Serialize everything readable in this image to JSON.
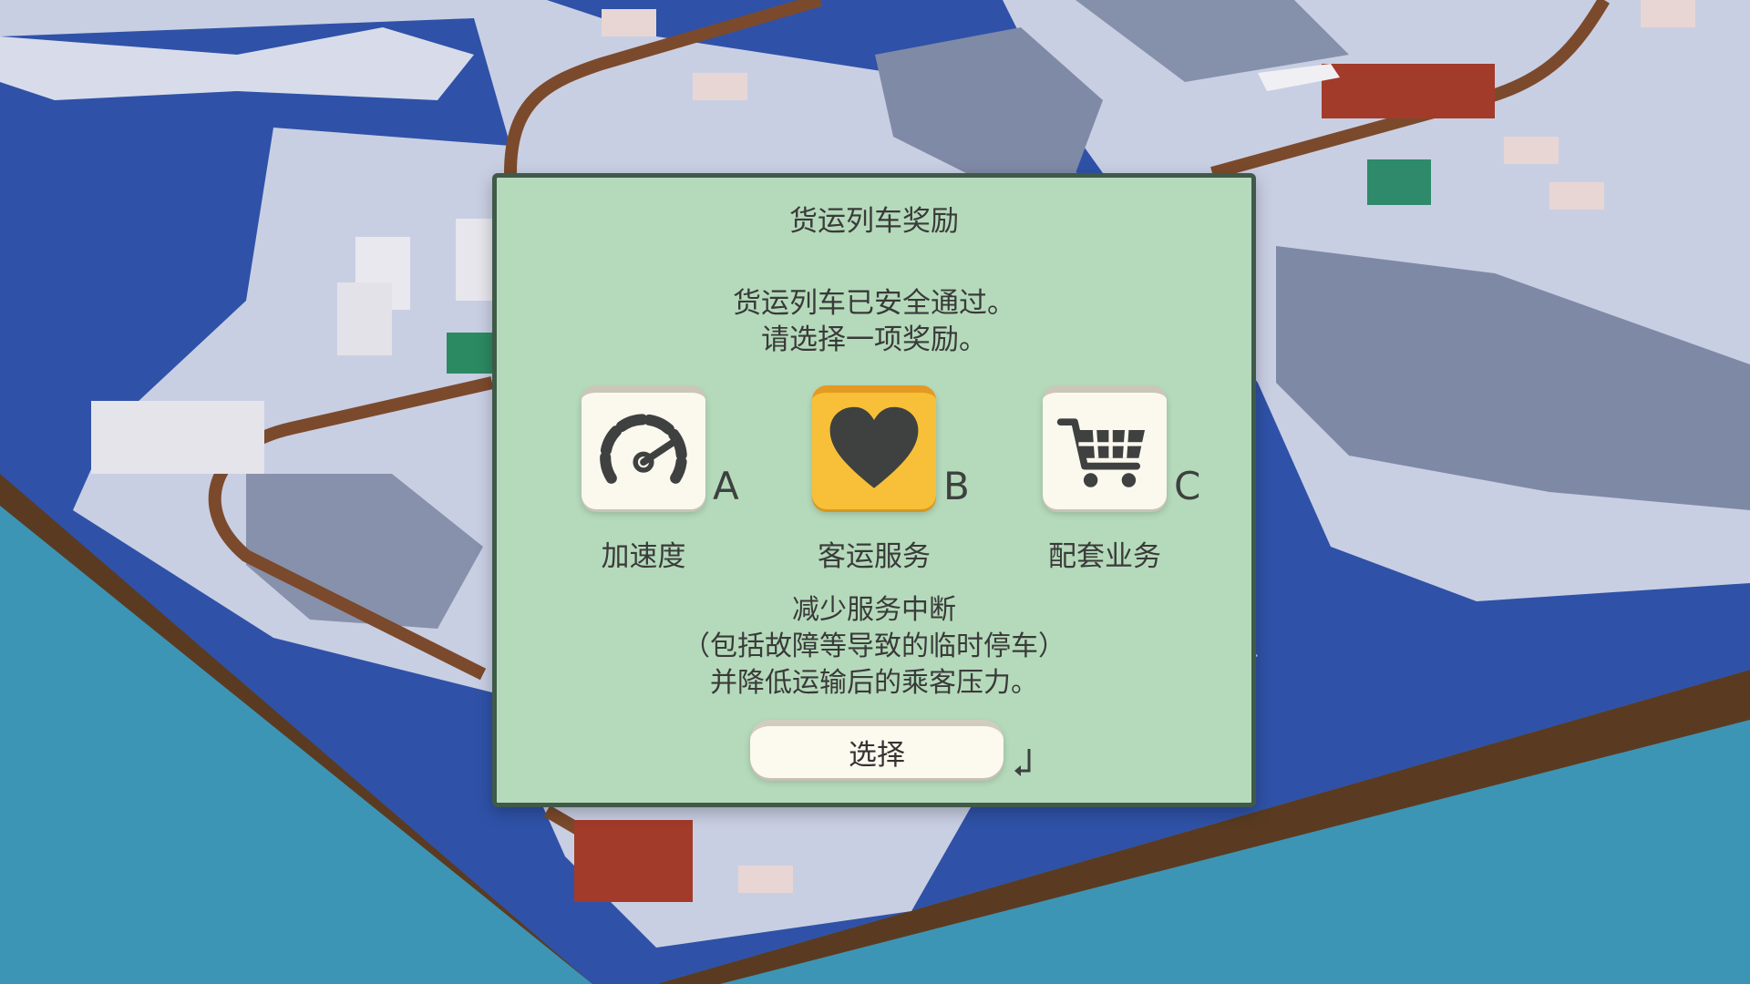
{
  "dialog": {
    "title": "货运列车奖励",
    "message_lines": [
      "货运列车已安全通过。",
      "请选择一项奖励。"
    ],
    "options": [
      {
        "key": "A",
        "label": "加速度",
        "icon": "speedometer-icon",
        "selected": false
      },
      {
        "key": "B",
        "label": "客运服务",
        "icon": "heart-icon",
        "selected": true
      },
      {
        "key": "C",
        "label": "配套业务",
        "icon": "shopping-cart-icon",
        "selected": false
      }
    ],
    "description_lines": [
      "减少服务中断",
      "（包括故障等导致的临时停车）",
      "并降低运输后的乘客压力。"
    ],
    "select_button": "选择",
    "confirm_key_icon": "enter-key-icon"
  },
  "colors": {
    "panel": "#b5dabb",
    "panel_border": "#3f5a48",
    "selected_tile": "#f8c038",
    "tile": "#fbf8ee",
    "icon": "#3e4140",
    "sea": "#3d95b5",
    "land": "#c9cfe3"
  }
}
